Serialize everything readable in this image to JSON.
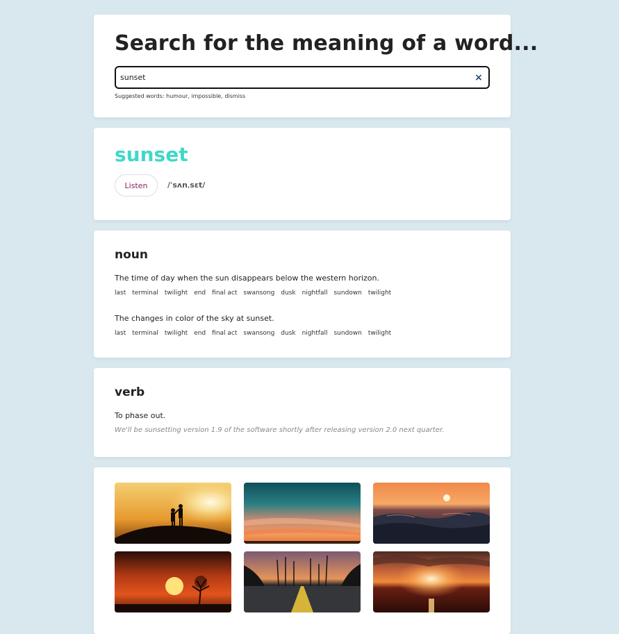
{
  "search": {
    "title": "Search for the meaning of a word...",
    "value": "sunset",
    "clear_icon": "×",
    "suggested_prefix": "Suggested words: ",
    "suggested": [
      "humour",
      "impossible",
      "dismiss"
    ]
  },
  "word": {
    "text": "sunset",
    "listen_label": "Listen",
    "phonetic": "/ˈsʌnˌsɛt/",
    "accent_color": "#40d8c8"
  },
  "noun": {
    "pos": "noun",
    "definitions": [
      {
        "text": "The time of day when the sun disappears below the western horizon.",
        "synonyms": [
          "last",
          "terminal",
          "twilight",
          "end",
          "final act",
          "swansong",
          "dusk",
          "nightfall",
          "sundown",
          "twilight"
        ]
      },
      {
        "text": "The changes in color of the sky at sunset.",
        "synonyms": [
          "last",
          "terminal",
          "twilight",
          "end",
          "final act",
          "swansong",
          "dusk",
          "nightfall",
          "sundown",
          "twilight"
        ]
      }
    ]
  },
  "verb": {
    "pos": "verb",
    "definition": "To phase out.",
    "example": "We'll be sunsetting version 1.9 of the software shortly after releasing version 2.0 next quarter."
  },
  "gallery": {
    "images": [
      "couple-silhouette-sunset-photo",
      "teal-orange-sky-photo",
      "ocean-wave-sunset-photo",
      "tree-silhouette-sunset-photo",
      "palm-road-sunset-photo",
      "sea-sunset-clouds-photo"
    ]
  }
}
